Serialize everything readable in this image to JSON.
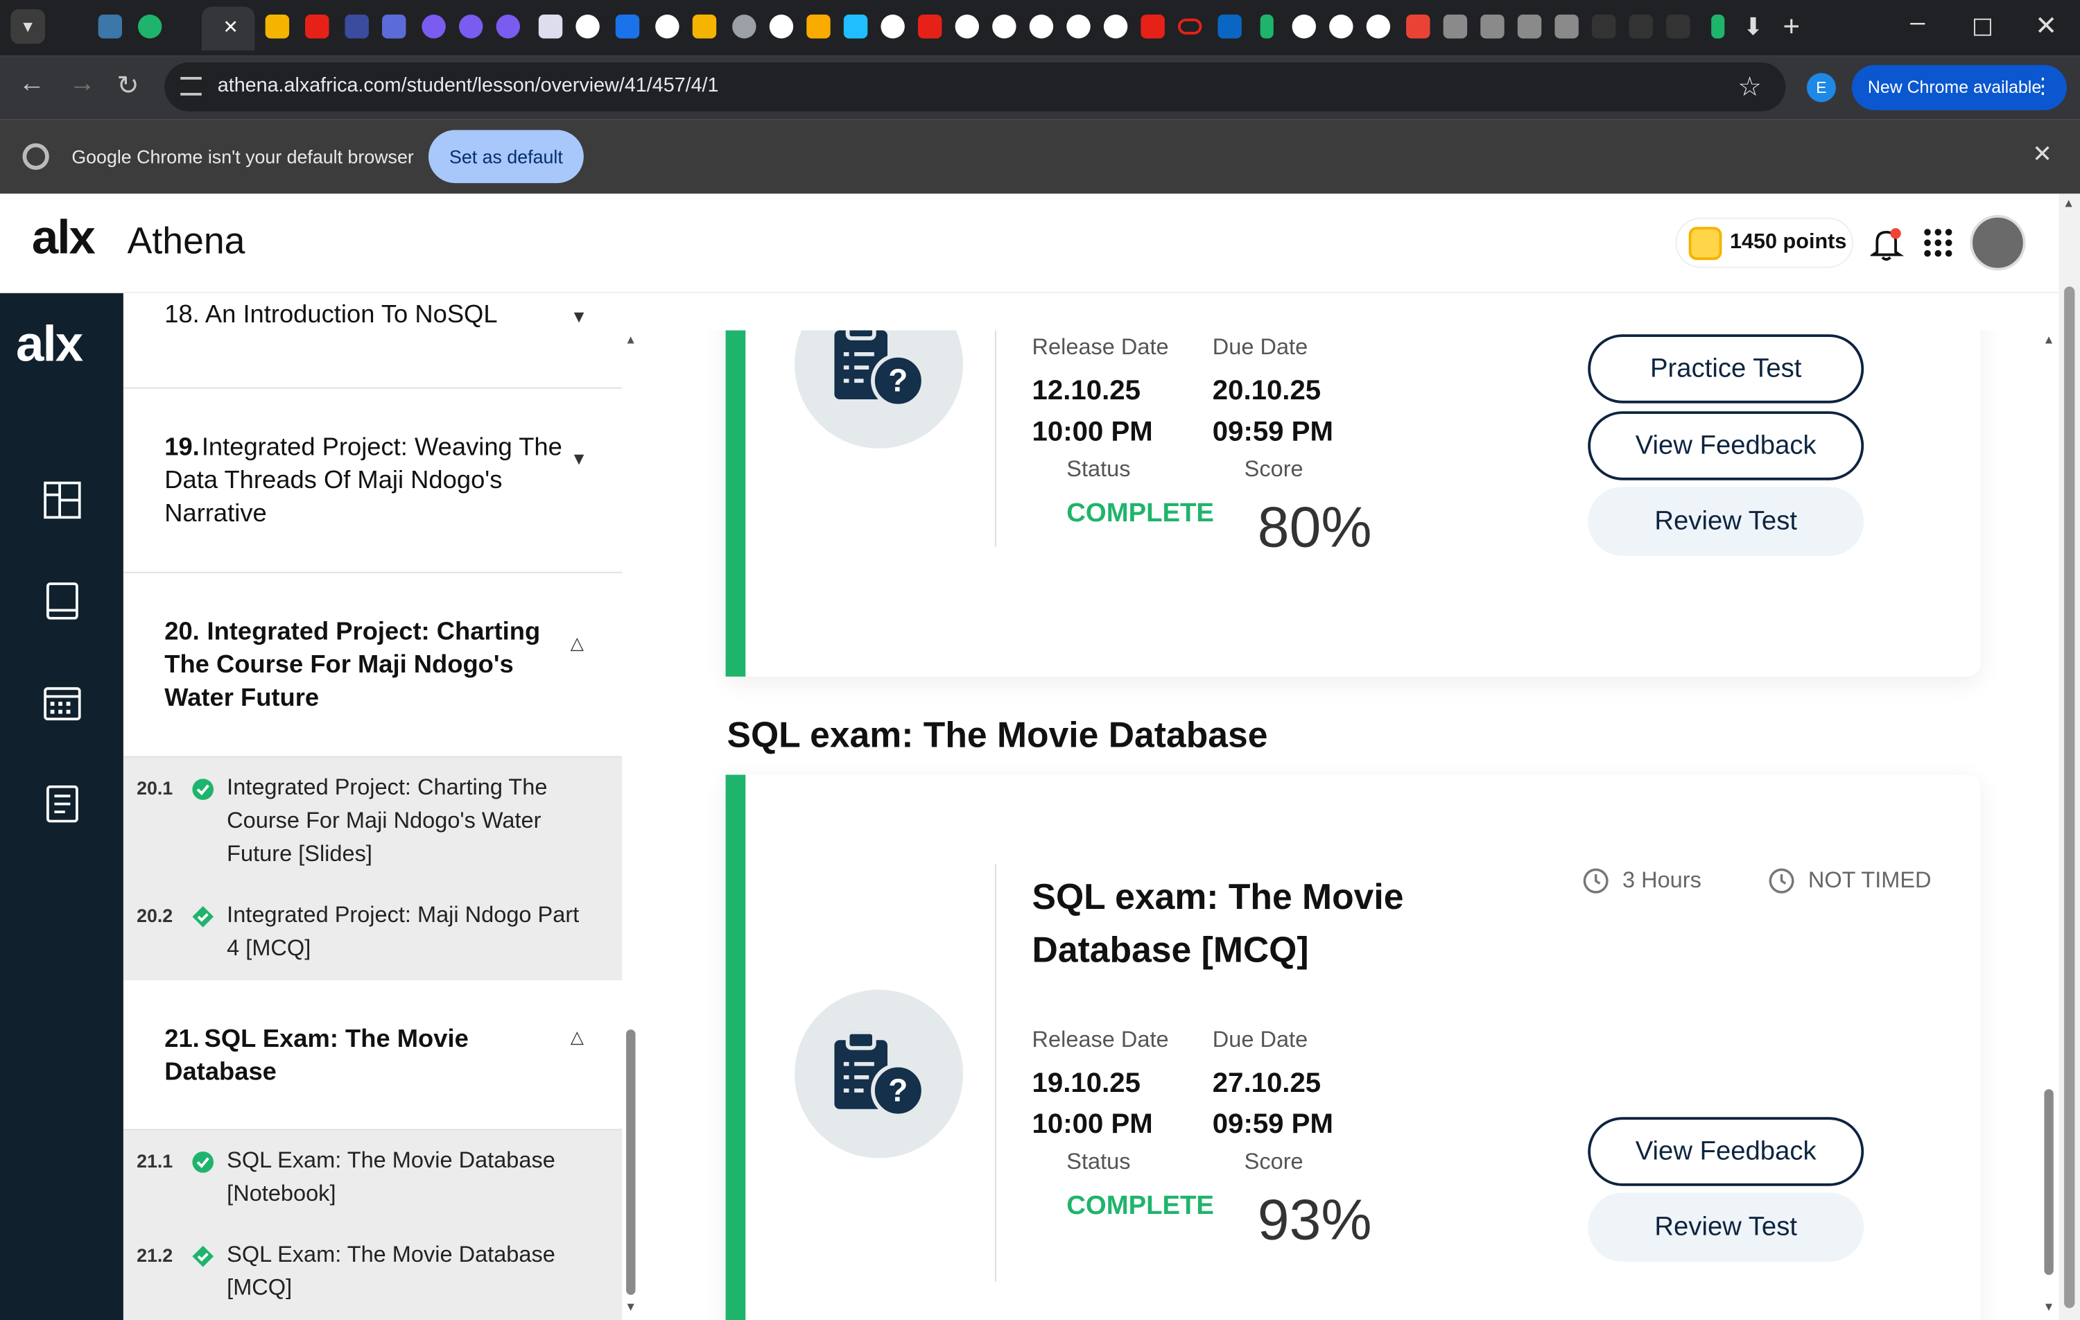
{
  "browser": {
    "url": "athena.alxafrica.com/student/lesson/overview/41/457/4/1",
    "profile_initial": "E",
    "update_label": "New Chrome available",
    "infobar_text": "Google Chrome isn't your default browser",
    "set_default_label": "Set as default",
    "tab_close": "✕"
  },
  "app": {
    "logo": "alx",
    "name": "Athena",
    "points": "1450 points"
  },
  "toc": {
    "partial_section": "18. An Introduction To NoSQL",
    "sections": [
      {
        "num": "19.",
        "title": "Integrated Project: Weaving The Data Threads Of Maji Ndogo's Narrative"
      },
      {
        "num": "20.",
        "title": "Integrated Project: Charting The Course For Maji Ndogo's Water Future"
      },
      {
        "num": "21.",
        "title": "SQL Exam: The Movie Database"
      }
    ],
    "items": [
      {
        "num": "20.1",
        "title": "Integrated Project: Charting The Course For Maji Ndogo's Water Future [Slides]"
      },
      {
        "num": "20.2",
        "title": "Integrated Project: Maji Ndogo Part 4 [MCQ]"
      },
      {
        "num": "21.1",
        "title": "SQL Exam: The Movie Database [Notebook]"
      },
      {
        "num": "21.2",
        "title": "SQL Exam: The Movie Database [MCQ]"
      }
    ]
  },
  "labels": {
    "release": "Release Date",
    "due": "Due Date",
    "status": "Status",
    "score": "Score"
  },
  "card1": {
    "release_date": "12.10.25",
    "release_time": "10:00 PM",
    "due_date": "20.10.25",
    "due_time": "09:59 PM",
    "status": "COMPLETE",
    "score": "80%",
    "btn_practice": "Practice Test",
    "btn_feedback": "View Feedback",
    "btn_review": "Review Test"
  },
  "section_heading": "SQL exam: The Movie Database",
  "card2": {
    "title": "SQL exam: The Movie Database [MCQ]",
    "duration": "3 Hours",
    "timed": "NOT TIMED",
    "release_date": "19.10.25",
    "release_time": "10:00 PM",
    "due_date": "27.10.25",
    "due_time": "09:59 PM",
    "status": "COMPLETE",
    "score": "93%",
    "btn_feedback": "View Feedback",
    "btn_review": "Review Test"
  },
  "colors": {
    "accent": "#1fb46c",
    "navy": "#0e2440",
    "rail": "#10212d"
  }
}
